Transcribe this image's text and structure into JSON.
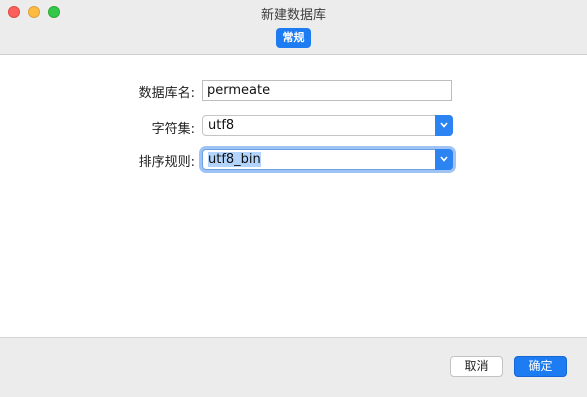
{
  "window": {
    "title": "新建数据库",
    "active_tab": "常规"
  },
  "form": {
    "db_name": {
      "label": "数据库名:",
      "value": "permeate"
    },
    "charset": {
      "label": "字符集:",
      "value": "utf8"
    },
    "collation": {
      "label": "排序规则:",
      "value": "utf8_bin"
    }
  },
  "buttons": {
    "cancel": "取消",
    "ok": "确定"
  },
  "colors": {
    "accent": "#1d7cf2",
    "close": "#fc605c",
    "minimize": "#fdbc40",
    "maximize": "#34c84a"
  }
}
